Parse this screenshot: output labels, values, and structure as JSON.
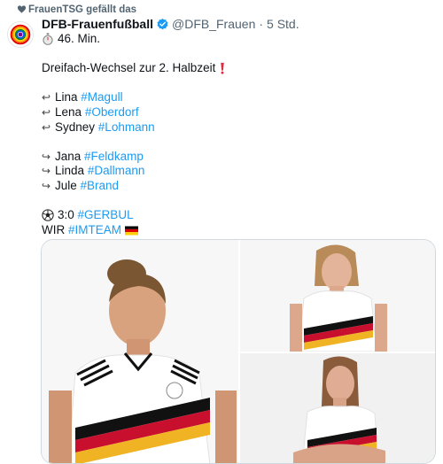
{
  "social_context": {
    "text": "FrauenTSG gefällt das",
    "icon": "heart-icon"
  },
  "tweet": {
    "author_name": "DFB-Frauenfußball",
    "handle": "@DFB_Frauen",
    "separator": "·",
    "time": "5 Std.",
    "lines": {
      "minute": "46. Min.",
      "headline": "Dreifach-Wechsel zur 2. Halbzeit",
      "out": [
        {
          "name": "Lina",
          "tag": "#Magull"
        },
        {
          "name": "Lena",
          "tag": "#Oberdorf"
        },
        {
          "name": "Sydney",
          "tag": "#Lohmann"
        }
      ],
      "in": [
        {
          "name": "Jana",
          "tag": "#Feldkamp"
        },
        {
          "name": "Linda",
          "tag": "#Dallmann"
        },
        {
          "name": "Jule",
          "tag": "#Brand"
        }
      ],
      "score": "3:0",
      "score_tag": "#GERBUL",
      "wir": "WIR",
      "wir_tag": "#IMTEAM"
    }
  },
  "colors": {
    "link": "#1d9bf0",
    "text": "#0f1419",
    "muted": "#536471",
    "verified": "#1d9bf0"
  },
  "icons": {
    "out_arrow": "return-left-arrow-icon",
    "in_arrow": "hook-right-arrow-icon",
    "stopwatch": "stopwatch-icon",
    "exclamation": "red-exclamation-icon",
    "ball": "soccer-ball-icon",
    "flag": "germany-flag-icon"
  }
}
